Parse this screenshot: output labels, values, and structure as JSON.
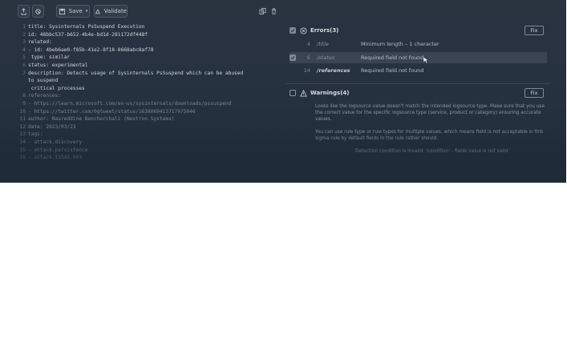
{
  "toolbar": {
    "upload_icon": "upload-icon",
    "copy_icon": "copy-icon",
    "save_label": "Save",
    "validate_label": "Validate"
  },
  "editor": {
    "lines": [
      {
        "n": "1",
        "text": "title: Sysinternals PsSuspend Execution"
      },
      {
        "n": "2",
        "text": "id: 48bbc537-b652-4b4e-bd1d-281172df448f"
      },
      {
        "n": "3",
        "text": "related:"
      },
      {
        "n": "4",
        "text": "- id: 4beb6ae0-f85b-41e2-8f18-8668abc8af78"
      },
      {
        "n": "5",
        "text": "  type: similar"
      },
      {
        "n": "6",
        "text": "status: experimental"
      },
      {
        "n": "7",
        "text": "description: Detects usage of Sysinternals PsSuspend which can be abused"
      },
      {
        "n": "",
        "text": "to suspend"
      },
      {
        "n": "",
        "text": "  critical processes"
      },
      {
        "n": "8",
        "text": "references:"
      },
      {
        "n": "9",
        "text": "- https://learn.microsoft.com/en-us/sysinternals/downloads/pssuspend"
      },
      {
        "n": "10",
        "text": "- https://twitter.com/0gtweet/status/1638069413717975046"
      },
      {
        "n": "11",
        "text": "author: Nasreddine Bencherchali (Nextron Systems)"
      },
      {
        "n": "12",
        "text": "date: 2023/03/23"
      },
      {
        "n": "13",
        "text": "tags:"
      },
      {
        "n": "14",
        "text": "- attack.discovery"
      },
      {
        "n": "15",
        "text": "- attack.persistence"
      },
      {
        "n": "16",
        "text": "- attack.t1543.003"
      }
    ]
  },
  "errors": {
    "title": "Errors(3)",
    "fix_label": "Fix",
    "rows": [
      {
        "line": "4",
        "path": "/title",
        "message": "Minimum length – 1 character"
      },
      {
        "line": "6",
        "path": "/status",
        "message": "Required field not found"
      },
      {
        "line": "14",
        "path": "/references",
        "message": "Required field not found"
      }
    ]
  },
  "warnings": {
    "title": "Warnings(4)",
    "fix_label": "Fix",
    "items": [
      "Looks like the logsource value doesn't match the intended logsource type. Make sure that you use the correct value for the specific logsource type (service, product or category) ensuring accurate values.",
      "You can use rule type or rule types for multiple values, which means field is not acceptable in this sigma rule by default fields in the rule rather should.",
      "Detection condition is invalid: 'condition' - fields value is not valid"
    ]
  },
  "colors": {
    "background": "#2a3340",
    "highlight_row": "#3a4452"
  }
}
